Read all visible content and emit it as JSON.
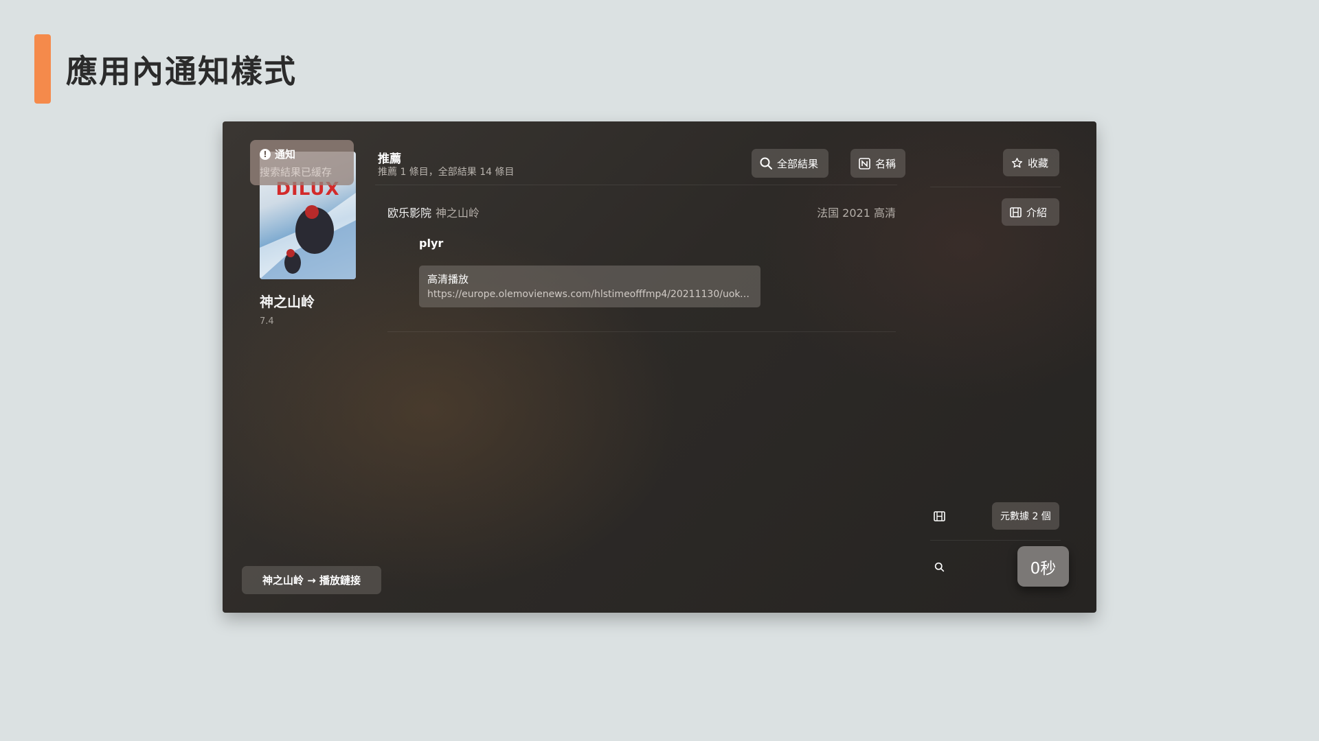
{
  "page": {
    "title": "應用內通知樣式"
  },
  "toast": {
    "title": "通知",
    "message": "搜索結果已緩存"
  },
  "movie": {
    "poster_text": "DILUX",
    "title": "神之山岭",
    "rating": "7.4"
  },
  "section": {
    "title": "推薦",
    "subtitle": "推薦 1 條目，全部結果 14 條目"
  },
  "toolbar": {
    "all_results": "全部結果",
    "name": "名稱",
    "favorite": "收藏",
    "intro": "介紹"
  },
  "result": {
    "source": "欧乐影院",
    "name": "神之山岭",
    "info": "法国 2021 高清",
    "player": "plyr",
    "play_title": "高清播放",
    "play_url": "https://europe.olemovienews.com/hlstimeofffmp4/20211130/uokozv..."
  },
  "side": {
    "metadata": "元數據 2 個",
    "timer": "0秒"
  },
  "breadcrumb": {
    "label": "神之山岭 → 播放鏈接"
  },
  "colors": {
    "accent": "#f58a4b",
    "background": "#dbe1e2"
  }
}
